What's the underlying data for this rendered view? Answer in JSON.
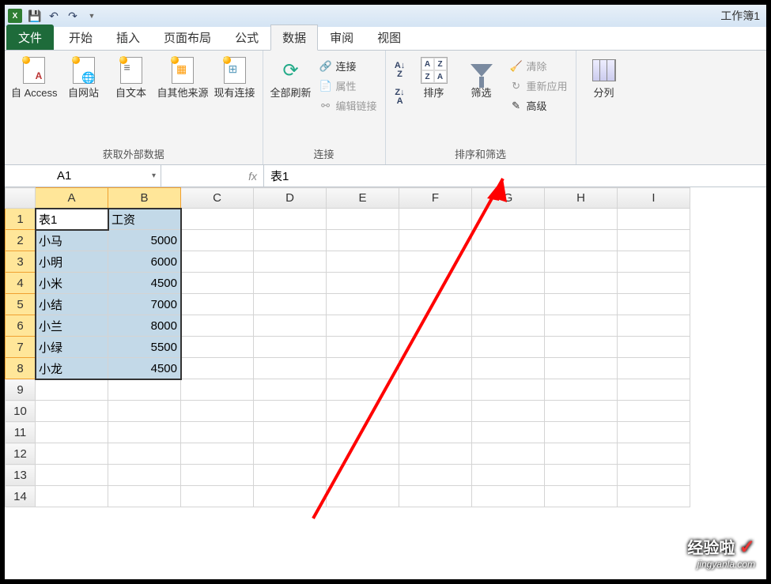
{
  "title": "工作簿1",
  "tabs": {
    "file": "文件",
    "home": "开始",
    "insert": "插入",
    "layout": "页面布局",
    "formulas": "公式",
    "data": "数据",
    "review": "审阅",
    "view": "视图"
  },
  "ribbon": {
    "ext_data": {
      "access": "自 Access",
      "web": "自网站",
      "text": "自文本",
      "other": "自其他来源",
      "existing": "现有连接",
      "group": "获取外部数据"
    },
    "connections": {
      "refresh": "全部刷新",
      "conn": "连接",
      "props": "属性",
      "edit": "编辑链接",
      "group": "连接"
    },
    "sort_filter": {
      "sort": "排序",
      "filter": "筛选",
      "clear": "清除",
      "reapply": "重新应用",
      "advanced": "高级",
      "group": "排序和筛选"
    },
    "data_tools": {
      "cols": "分列"
    }
  },
  "formula_bar": {
    "name": "A1",
    "fx": "fx",
    "value": "表1"
  },
  "columns": [
    "A",
    "B",
    "C",
    "D",
    "E",
    "F",
    "G",
    "H",
    "I"
  ],
  "rows": [
    "1",
    "2",
    "3",
    "4",
    "5",
    "6",
    "7",
    "8",
    "9",
    "10",
    "11",
    "12",
    "13",
    "14"
  ],
  "table": [
    {
      "a": "表1",
      "b": "工资"
    },
    {
      "a": "小马",
      "b": "5000"
    },
    {
      "a": "小明",
      "b": "6000"
    },
    {
      "a": "小米",
      "b": "4500"
    },
    {
      "a": "小结",
      "b": "7000"
    },
    {
      "a": "小兰",
      "b": "8000"
    },
    {
      "a": "小绿",
      "b": "5500"
    },
    {
      "a": "小龙",
      "b": "4500"
    }
  ],
  "sort_small": {
    "az_top": "A",
    "az_bot": "Z",
    "za_top": "Z",
    "za_bot": "A",
    "arrow": "↓"
  },
  "watermark": {
    "top": "经验啦",
    "check": "✓",
    "bot": "jingyanla.com"
  }
}
